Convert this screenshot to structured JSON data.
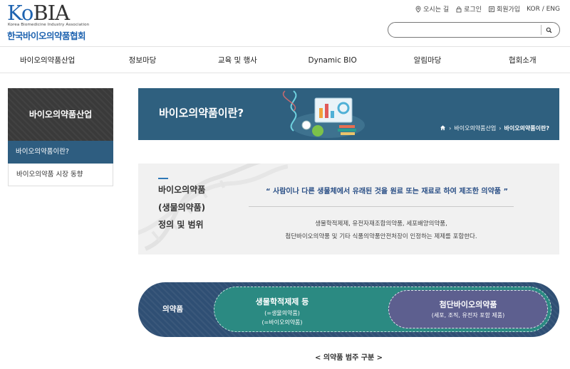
{
  "logo": {
    "main_ko": "Ko",
    "main_bia": "BIA",
    "subtitle_en": "Korea Biomedicine Industry Association",
    "name_kr": "한국바이오의약품협회"
  },
  "utility": {
    "directions": "오시는 길",
    "login": "로그인",
    "signup": "회원가입",
    "language": "KOR / ENG"
  },
  "search": {
    "placeholder": "",
    "value": ""
  },
  "nav": {
    "items": [
      {
        "label": "바이오의약품산업"
      },
      {
        "label": "정보마당"
      },
      {
        "label": "교육 및 행사"
      },
      {
        "label": "Dynamic BIO"
      },
      {
        "label": "알림마당"
      },
      {
        "label": "협회소개"
      }
    ]
  },
  "sidebar": {
    "title": "바이오의약품산업",
    "items": [
      {
        "label": "바이오의약품이란?",
        "active": true
      },
      {
        "label": "바이오의약품 시장 동향",
        "active": false
      }
    ]
  },
  "banner": {
    "title": "바이오의약품이란?",
    "breadcrumb": [
      "바이오의약품산업",
      "바이오의약품이란?"
    ]
  },
  "definition": {
    "title_lines": [
      "바이오의약품",
      "(생물의약품)",
      "정의 및 범위"
    ],
    "quote": "“ 사람이나 다른 생물체에서 유래된 것을 원료 또는 재료로 하여 제조한 의약품 ”",
    "desc_lines": [
      "생물학적제제, 유전자재조합의약품, 세포배양의약품,",
      "첨단바이오의약품 및 기타 식품의약품안전처장이 인정하는 제제를 포함한다."
    ]
  },
  "categories": {
    "outer": "의약품",
    "middle": {
      "title": "생물학적제제 등",
      "sub1": "(=생물의약품)",
      "sub2": "(=바이오의약품)"
    },
    "inner": {
      "title": "첨단바이오의약품",
      "sub": "(세포, 조직, 유전자 포함 제품)"
    },
    "caption": "< 의약품 범주 구분 >"
  },
  "colors": {
    "brand_blue": "#1e63b0",
    "banner_bg": "#2f607f",
    "sidebar_active": "#2e5d80",
    "outer_pill": "#2f4f74",
    "middle_pill": "#2b8a82",
    "inner_pill": "#5d5f8f"
  },
  "icons": [
    "location-pin-icon",
    "lock-icon",
    "user-add-icon",
    "search-icon",
    "home-icon",
    "chevron-right-icon"
  ]
}
